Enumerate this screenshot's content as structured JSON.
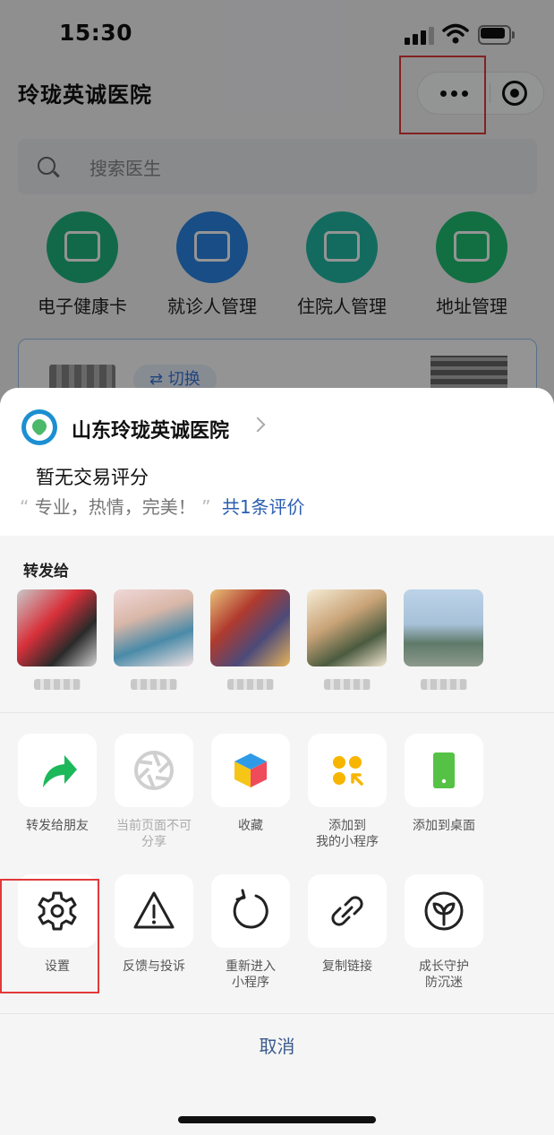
{
  "status_bar": {
    "time": "15:30"
  },
  "app": {
    "title": "玲珑英诚医院",
    "search_placeholder": "搜索医生",
    "quick_actions": [
      {
        "label": "电子健康卡",
        "color": "#1fb57f",
        "icon": "health-card-icon"
      },
      {
        "label": "就诊人管理",
        "color": "#2a86e6",
        "icon": "patient-id-icon"
      },
      {
        "label": "住院人管理",
        "color": "#21b8a4",
        "icon": "inpatient-doc-icon"
      },
      {
        "label": "地址管理",
        "color": "#1fbf72",
        "icon": "address-book-icon"
      }
    ],
    "card": {
      "switch_label": "⇄ 切换"
    }
  },
  "sheet": {
    "hospital_name": "山东玲珑英诚医院",
    "rating_text": "暂无交易评分",
    "review_open_quote": "“",
    "review_text": "专业，热情，完美！",
    "review_close_quote": "”",
    "review_count": "共1条评价",
    "share_to_label": "转发给",
    "row1": [
      {
        "label_lines": [
          "转发给朋友"
        ],
        "icon": "forward-arrow-icon",
        "enabled": true
      },
      {
        "label_lines": [
          "当前页面不可",
          "分享"
        ],
        "icon": "aperture-icon",
        "enabled": false
      },
      {
        "label_lines": [
          "收藏"
        ],
        "icon": "favorite-cube-icon",
        "enabled": true
      },
      {
        "label_lines": [
          "添加到",
          "我的小程序"
        ],
        "icon": "mini-program-icon",
        "enabled": true
      },
      {
        "label_lines": [
          "添加到桌面"
        ],
        "icon": "add-to-desktop-icon",
        "enabled": true
      }
    ],
    "row2": [
      {
        "label_lines": [
          "设置"
        ],
        "icon": "gear-icon",
        "enabled": true
      },
      {
        "label_lines": [
          "反馈与投诉"
        ],
        "icon": "warning-triangle-icon",
        "enabled": true
      },
      {
        "label_lines": [
          "重新进入",
          "小程序"
        ],
        "icon": "refresh-icon",
        "enabled": true
      },
      {
        "label_lines": [
          "复制链接"
        ],
        "icon": "link-icon",
        "enabled": true
      },
      {
        "label_lines": [
          "成长守护",
          "防沉迷"
        ],
        "icon": "sprout-icon",
        "enabled": true
      }
    ],
    "cancel_label": "取消"
  }
}
